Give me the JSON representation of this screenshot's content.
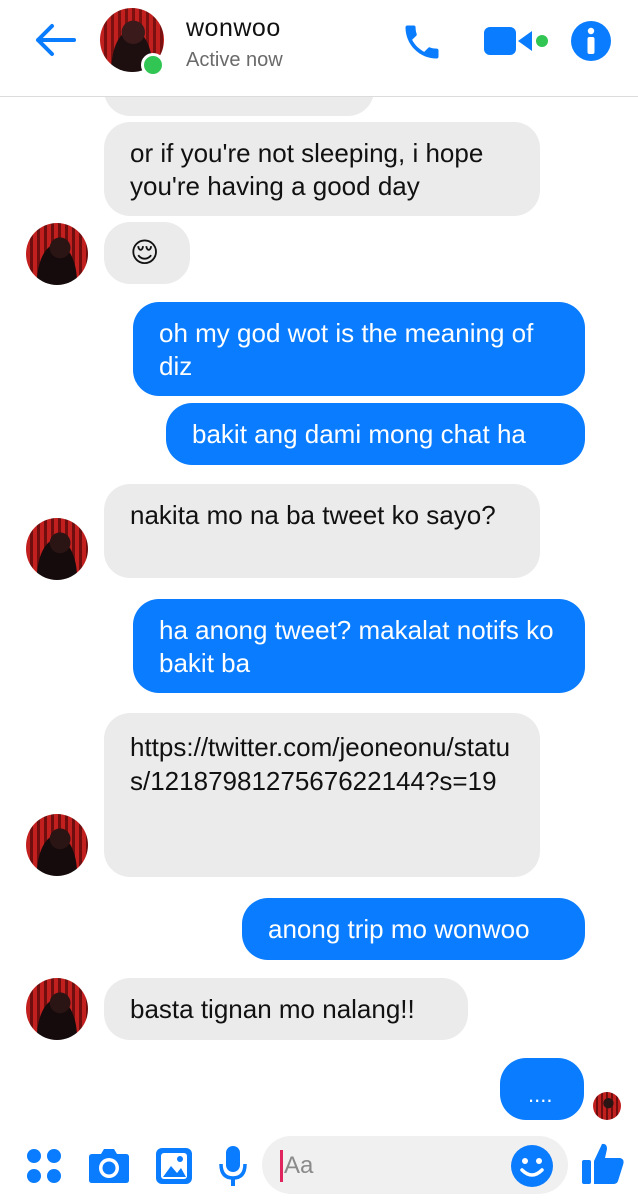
{
  "header": {
    "name": "wonwoo",
    "status": "Active now"
  },
  "messages": [
    {
      "side": "in",
      "text": "or if you're not sleeping, i hope you're having a good day"
    },
    {
      "side": "in",
      "text": "😌"
    },
    {
      "side": "out",
      "text": "oh my god wot is the meaning of diz"
    },
    {
      "side": "out",
      "text": "bakit ang dami mong chat ha"
    },
    {
      "side": "in",
      "text": "nakita mo na ba tweet ko sayo?"
    },
    {
      "side": "out",
      "text": "ha anong tweet? makalat notifs ko bakit ba"
    },
    {
      "side": "in",
      "text": "https://twitter.com/jeoneonu/status/1218798127567622144?s=19"
    },
    {
      "side": "out",
      "text": "anong trip mo wonwoo"
    },
    {
      "side": "in",
      "text": "basta tignan mo nalang!!"
    },
    {
      "side": "out",
      "text": "...."
    }
  ],
  "composer": {
    "placeholder": "Aa"
  },
  "colors": {
    "accent": "#0a7cff",
    "incoming_bubble": "#ebebeb",
    "presence": "#31c553"
  },
  "icons": [
    "back-arrow-icon",
    "phone-icon",
    "video-camera-icon",
    "info-icon",
    "apps-icon",
    "camera-icon",
    "gallery-icon",
    "microphone-icon",
    "emoji-icon",
    "thumbs-up-icon"
  ]
}
